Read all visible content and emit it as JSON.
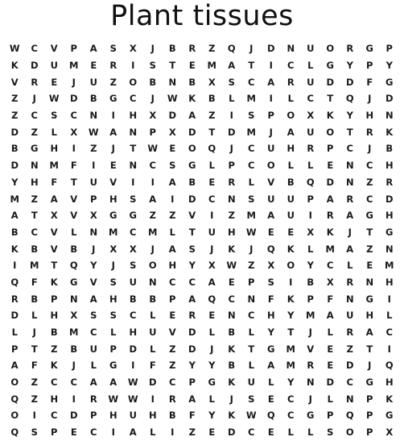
{
  "title": "Plant tissues",
  "grid": [
    "WCVPASXJBRZQJDNUORGPTWRE",
    "KDUMERISTEMATICLGYPYCLUD",
    "VREJUZOBNBXSCARUDDFGUHCV",
    "ZJWDBGCJWKBLMILCTQJDEHJG",
    "ZCSCNIHXDAZISPOXKYHNXONE",
    "DZLXWANPXDTDMJAUOTRKUOSZ",
    "BGHIZJTWEOQJCUHRPCJBIKHR",
    "DNMFIENCSGLPCOLLENCHYMAE",
    "YHFTUVIIABERLVBQDNZROEIZ",
    "MZAVPHSAIDCNSUUPARCDDOYP",
    "ATXVXGGZZVIZMAUIRAGHJVIY",
    "BCVLNMCMLTUHWEEXKJTGYUUP",
    "KBVBJXXJASJKJQKLMAZNWVMJI",
    "IMTQYJSOHYXWZXOYCLEMHXAR",
    "QFKGVSUNCCAEPSIBXRNHCSQD",
    "RBPNAHBBPAQCNFKPFNGIOFRT",
    "DLHXSSCLERENCHYMAUHLMKCX",
    "LJBMCLHUVDLBLYTJLRACENSK",
    "PTZBUPDLZDJKTGMVEZTIORRE",
    "AFKJLGIFZYYBLAMREDJQLGXG",
    "OZCCAAWDCPGKULYNDCGHGQCC",
    "QZHIRWWIRALJSECJLNPKPCGC",
    "OICDPHUHBFYKWQCGPQPGGKGT",
    "QSPECIALIZEDCELLSOPXWZET"
  ]
}
